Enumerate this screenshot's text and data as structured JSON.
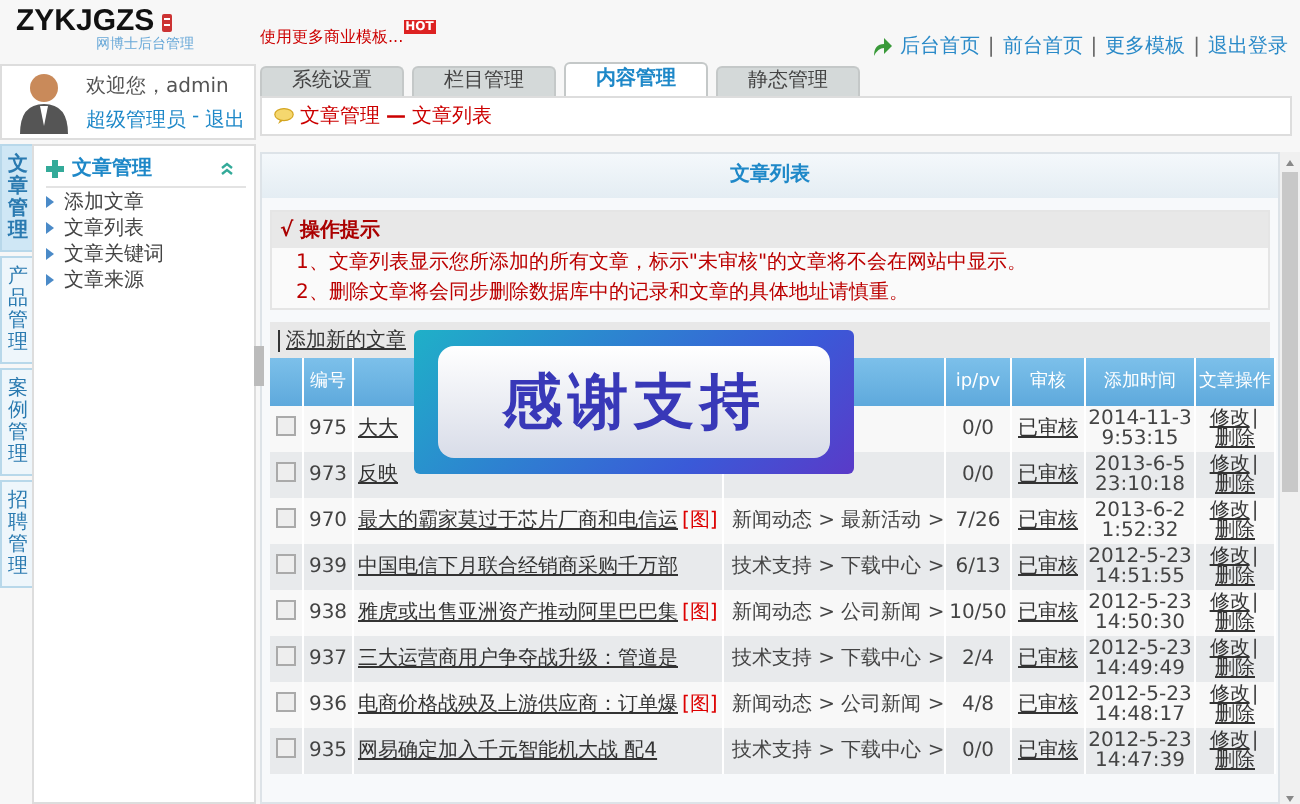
{
  "logo": {
    "title": "ZYKJGZS",
    "subtitle": "网博士后台管理"
  },
  "promo": {
    "text": "使用更多商业模板...",
    "badge": "HOT"
  },
  "top_links": [
    "后台首页",
    "前台首页",
    "更多模板",
    "退出登录"
  ],
  "top_link_separator": "|",
  "user": {
    "greeting": "欢迎您，admin",
    "role": "超级管理员",
    "dash": "-",
    "logout": "退出"
  },
  "side_tabs": [
    {
      "label": "文章管理",
      "selected": true
    },
    {
      "label": "产品管理",
      "selected": false
    },
    {
      "label": "案例管理",
      "selected": false
    },
    {
      "label": "招聘管理",
      "selected": false
    }
  ],
  "sidebar": {
    "title": "文章管理",
    "expanded": true,
    "items": [
      "添加文章",
      "文章列表",
      "文章关键词",
      "文章来源"
    ]
  },
  "tabs": [
    {
      "label": "系统设置",
      "selected": false
    },
    {
      "label": "栏目管理",
      "selected": false
    },
    {
      "label": "内容管理",
      "selected": true
    },
    {
      "label": "静态管理",
      "selected": false
    }
  ],
  "breadcrumb": [
    "文章管理",
    "—",
    "文章列表"
  ],
  "panel_title": "文章列表",
  "tips": {
    "title": "√ 操作提示",
    "lines": [
      "1、文章列表显示您所添加的所有文章，标示\"未审核\"的文章将不会在网站中显示。",
      "2、删除文章将会同步删除数据库中的记录和文章的具体地址请慎重。"
    ]
  },
  "add_link": "添加新的文章",
  "op_separator": "|",
  "table": {
    "columns": [
      "",
      "编号",
      "",
      "",
      "ip/pv",
      "审核",
      "添加时间",
      "文章操作"
    ],
    "rows": [
      {
        "checked": false,
        "id": "975",
        "title": "大大",
        "image_tag": "",
        "category": "",
        "ippv": "0/0",
        "status": "已审核",
        "date": "2014-11-3",
        "time": "9:53:15",
        "edit": "修改",
        "delete": "删除"
      },
      {
        "checked": false,
        "id": "973",
        "title": "反映",
        "image_tag": "",
        "category": "",
        "ippv": "0/0",
        "status": "已审核",
        "date": "2013-6-5",
        "time": "23:10:18",
        "edit": "修改",
        "delete": "删除"
      },
      {
        "checked": false,
        "id": "970",
        "title": "最大的霸家莫过于芯片厂商和电信运",
        "image_tag": "[图]",
        "category": "新闻动态 > 最新活动 >",
        "ippv": "7/26",
        "status": "已审核",
        "date": "2013-6-2",
        "time": "1:52:32",
        "edit": "修改",
        "delete": "删除"
      },
      {
        "checked": false,
        "id": "939",
        "title": "中国电信下月联合经销商采购千万部",
        "image_tag": "",
        "category": "技术支持 > 下载中心 >",
        "ippv": "6/13",
        "status": "已审核",
        "date": "2012-5-23",
        "time": "14:51:55",
        "edit": "修改",
        "delete": "删除"
      },
      {
        "checked": false,
        "id": "938",
        "title": "雅虎或出售亚洲资产推动阿里巴巴集",
        "image_tag": "[图]",
        "category": "新闻动态 > 公司新闻 >",
        "ippv": "10/50",
        "status": "已审核",
        "date": "2012-5-23",
        "time": "14:50:30",
        "edit": "修改",
        "delete": "删除"
      },
      {
        "checked": false,
        "id": "937",
        "title": "三大运营商用户争夺战升级：管道是",
        "image_tag": "",
        "category": "技术支持 > 下载中心 >",
        "ippv": "2/4",
        "status": "已审核",
        "date": "2012-5-23",
        "time": "14:49:49",
        "edit": "修改",
        "delete": "删除"
      },
      {
        "checked": false,
        "id": "936",
        "title": "电商价格战殃及上游供应商：订单爆",
        "image_tag": "[图]",
        "category": "新闻动态 > 公司新闻 >",
        "ippv": "4/8",
        "status": "已审核",
        "date": "2012-5-23",
        "time": "14:48:17",
        "edit": "修改",
        "delete": "删除"
      },
      {
        "checked": false,
        "id": "935",
        "title": "网易确定加入千元智能机大战 配4",
        "image_tag": "",
        "category": "技术支持 > 下载中心 >",
        "ippv": "0/0",
        "status": "已审核",
        "date": "2012-5-23",
        "time": "14:47:39",
        "edit": "修改",
        "delete": "删除"
      }
    ]
  },
  "overlay": {
    "text": "感谢支持"
  }
}
